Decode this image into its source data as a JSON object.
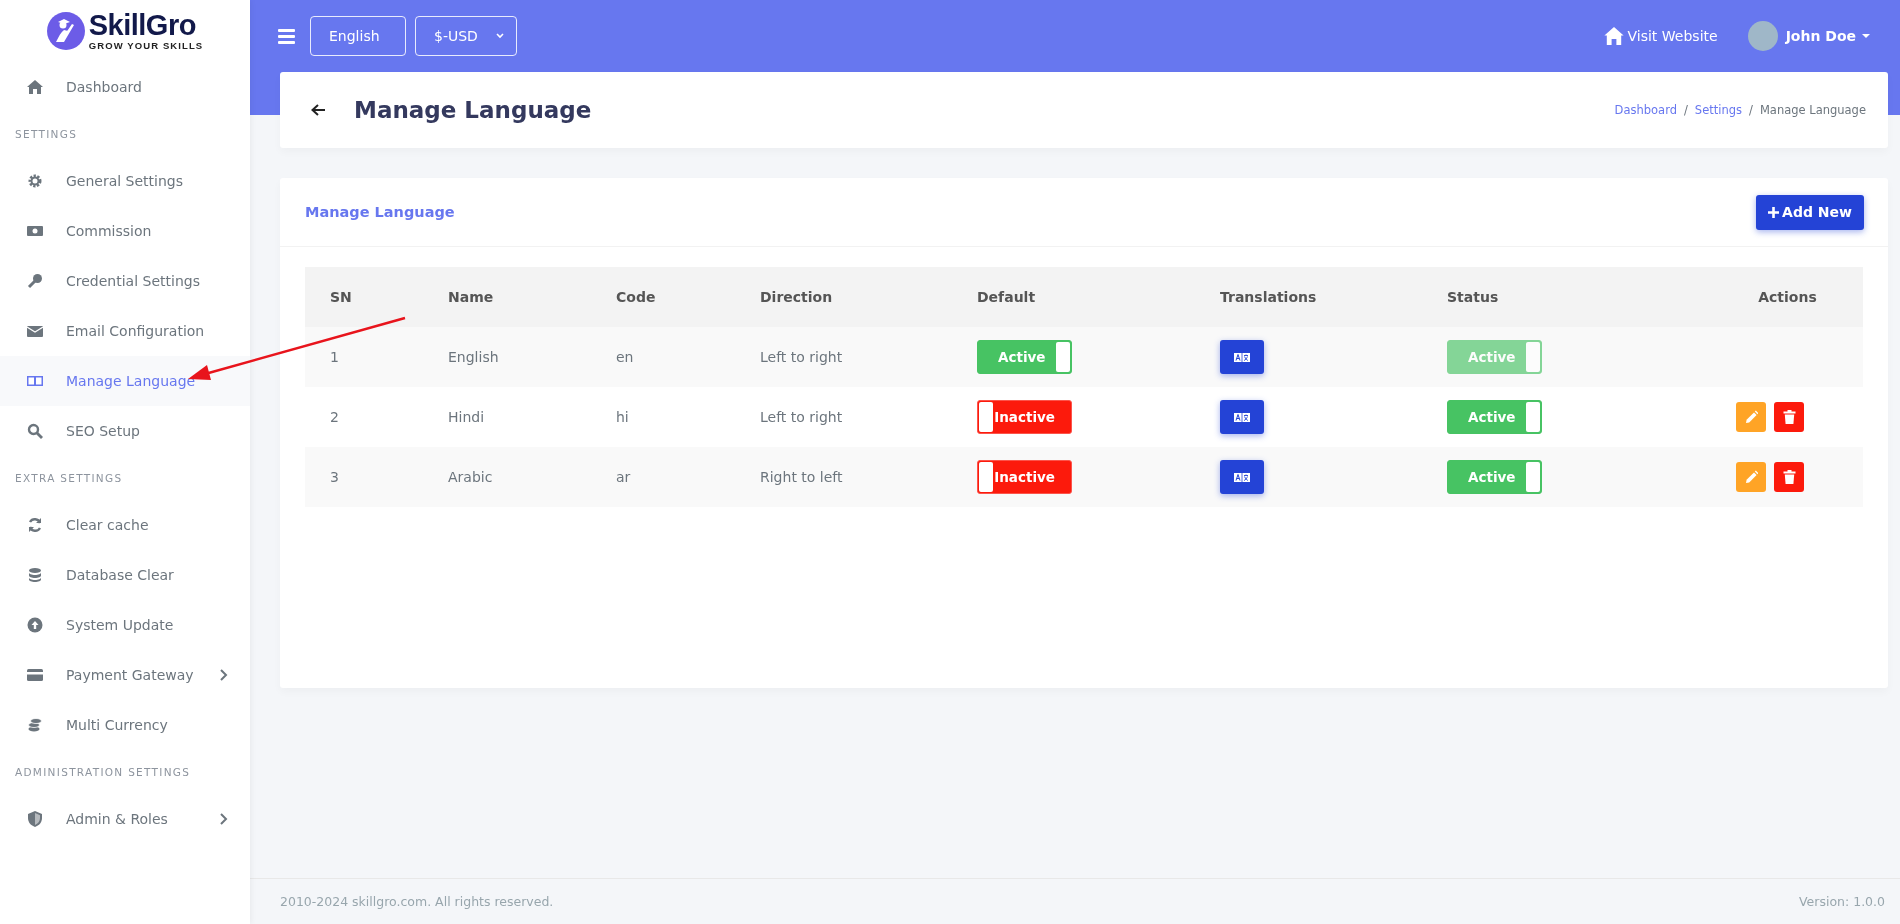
{
  "brand": {
    "name": "SkillGro",
    "tagline": "GROW YOUR SKILLS"
  },
  "sidebar": {
    "sections": [
      {
        "items": [
          {
            "label": "Dashboard",
            "kind": "home",
            "selected": false,
            "expandable": false
          }
        ]
      },
      {
        "heading": "SETTINGS",
        "items": [
          {
            "label": "General Settings",
            "kind": "gear",
            "selected": false,
            "expandable": false
          },
          {
            "label": "Commission",
            "kind": "money",
            "selected": false,
            "expandable": false
          },
          {
            "label": "Credential Settings",
            "kind": "key",
            "selected": false,
            "expandable": false
          },
          {
            "label": "Email Configuration",
            "kind": "envelope",
            "selected": false,
            "expandable": false
          },
          {
            "label": "Manage Language",
            "kind": "language",
            "selected": true,
            "expandable": false
          },
          {
            "label": "SEO Setup",
            "kind": "search",
            "selected": false,
            "expandable": false
          }
        ]
      },
      {
        "heading": "EXTRA SETTINGS",
        "items": [
          {
            "label": "Clear cache",
            "kind": "refresh",
            "selected": false,
            "expandable": false
          },
          {
            "label": "Database Clear",
            "kind": "database",
            "selected": false,
            "expandable": false
          },
          {
            "label": "System Update",
            "kind": "upload",
            "selected": false,
            "expandable": false
          },
          {
            "label": "Payment Gateway",
            "kind": "card",
            "selected": false,
            "expandable": true
          },
          {
            "label": "Multi Currency",
            "kind": "coins",
            "selected": false,
            "expandable": false
          }
        ]
      },
      {
        "heading": "ADMINISTRATION SETTINGS",
        "items": [
          {
            "label": "Admin & Roles",
            "kind": "shield",
            "selected": false,
            "expandable": true
          }
        ]
      }
    ]
  },
  "topbar": {
    "language_select": "English",
    "currency_select": "$-USD",
    "visit_website": "Visit Website",
    "user_name": "John Doe"
  },
  "page_header": {
    "title": "Manage Language",
    "breadcrumb": [
      {
        "label": "Dashboard",
        "kind": "link"
      },
      {
        "label": "/",
        "kind": "separator"
      },
      {
        "label": "Settings",
        "kind": "link"
      },
      {
        "label": "/",
        "kind": "separator"
      },
      {
        "label": "Manage Language",
        "kind": "current"
      }
    ]
  },
  "card": {
    "title": "Manage Language",
    "add_button": "Add New",
    "table": {
      "columns": [
        "SN",
        "Name",
        "Code",
        "Direction",
        "Default",
        "Translations",
        "Status",
        "Actions"
      ],
      "rows": [
        {
          "sn": "1",
          "name": "English",
          "code": "en",
          "direction": "Left to right",
          "default": {
            "label": "Active",
            "on": true
          },
          "status": {
            "label": "Active",
            "on": true,
            "disabled": true
          },
          "editable": false
        },
        {
          "sn": "2",
          "name": "Hindi",
          "code": "hi",
          "direction": "Left to right",
          "default": {
            "label": "Inactive",
            "on": false
          },
          "status": {
            "label": "Active",
            "on": true,
            "disabled": false
          },
          "editable": true
        },
        {
          "sn": "3",
          "name": "Arabic",
          "code": "ar",
          "direction": "Right to left",
          "default": {
            "label": "Inactive",
            "on": false
          },
          "status": {
            "label": "Active",
            "on": true,
            "disabled": false
          },
          "editable": true
        }
      ]
    }
  },
  "footer": {
    "copyright": "2010-2024 skillgro.com. All rights reserved.",
    "version": "Version: 1.0.0"
  }
}
